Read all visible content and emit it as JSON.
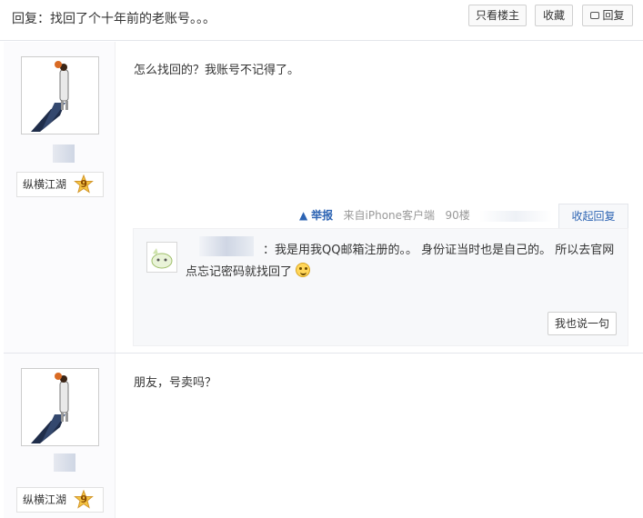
{
  "thread": {
    "title": "回复：找回了个十年前的老账号。。。"
  },
  "toolbar": {
    "only_op": "只看楼主",
    "favorite": "收藏",
    "reply": "回复"
  },
  "posts": [
    {
      "level_name": "纵横江湖",
      "level_num": "9",
      "content": "怎么找回的？我账号不记得了。",
      "tail": {
        "report": "举报",
        "source": "来自iPhone客户端",
        "floor": "90楼",
        "collapse": "收起回复"
      },
      "sub_replies": [
        {
          "text": "：我是用我QQ邮箱注册的。。 身份证当时也是自己的。 所以去官网点忘记密码就找回了"
        }
      ],
      "say_one": "我也说一句"
    },
    {
      "level_name": "纵横江湖",
      "level_num": "9",
      "content": "朋友，号卖吗？"
    }
  ],
  "icons": [
    "reply-icon",
    "report-icon",
    "level-star-icon",
    "smile-emoji-icon"
  ],
  "colors": {
    "link": "#2d64b3",
    "badge": "#f2b233",
    "border": "#e4e6eb"
  }
}
